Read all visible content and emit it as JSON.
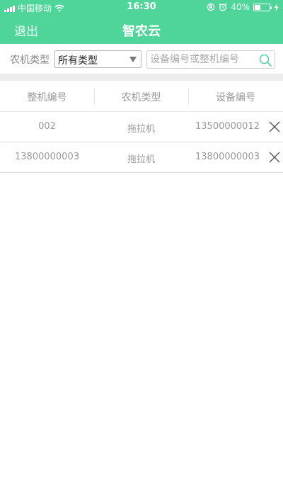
{
  "status_bar": {
    "carrier": "中国移动",
    "time": "16:30",
    "battery_percent": "40%",
    "battery_level": 0.4,
    "icons": [
      "signal-icon",
      "wifi-icon",
      "rotation-lock-icon",
      "alarm-icon",
      "battery-icon",
      "charging-icon"
    ]
  },
  "nav": {
    "back_label": "退出",
    "title": "智农云"
  },
  "filter": {
    "type_label": "农机类型",
    "type_selected": "所有类型",
    "search_placeholder": "设备编号或整机编号",
    "search_value": ""
  },
  "table": {
    "headers": [
      "整机编号",
      "农机类型",
      "设备编号"
    ],
    "rows": [
      {
        "machine_no": "002",
        "type": "拖拉机",
        "device_no": "13500000012"
      },
      {
        "machine_no": "13800000003",
        "type": "拖拉机",
        "device_no": "13800000003"
      }
    ]
  },
  "colors": {
    "accent": "#4fd59a",
    "search_icon": "#5fcfa8",
    "text_muted": "#999999"
  }
}
